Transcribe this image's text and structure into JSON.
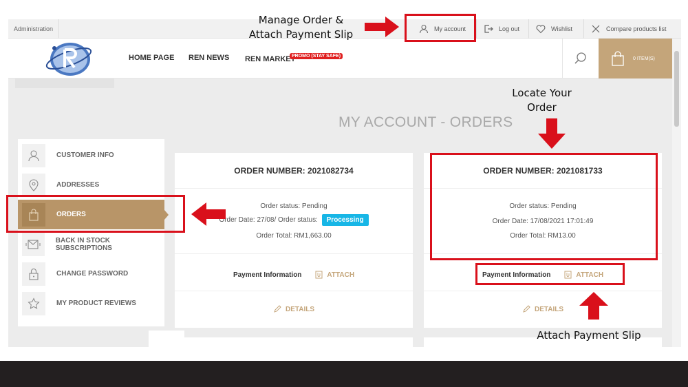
{
  "topbar": {
    "admin": "Administration",
    "my_account": "My account",
    "logout": "Log out",
    "wishlist": "Wishlist",
    "compare": "Compare products list"
  },
  "header": {
    "nav": [
      "HOME PAGE",
      "REN NEWS",
      "REN MARKET"
    ],
    "promo_badge": "PROMO (STAY SAFE)",
    "cart_label": "0 ITEM(S)"
  },
  "page_title": "MY ACCOUNT - ORDERS",
  "sidebar": {
    "items": [
      {
        "label": "CUSTOMER INFO",
        "icon": "user-icon"
      },
      {
        "label": "ADDRESSES",
        "icon": "location-pin-icon"
      },
      {
        "label": "ORDERS",
        "icon": "bag-icon"
      },
      {
        "label": "BACK IN STOCK SUBSCRIPTIONS",
        "icon": "envelope-icon"
      },
      {
        "label": "CHANGE PASSWORD",
        "icon": "lock-icon"
      },
      {
        "label": "MY PRODUCT REVIEWS",
        "icon": "star-icon"
      }
    ],
    "active_index": 2
  },
  "orders": [
    {
      "title": "ORDER NUMBER: 2021082734",
      "status": "Order status: Pending",
      "date_prefix": "Order Date: 27/08/",
      "overlay_status": "Order status:",
      "badge": "Processing",
      "total": "Order Total: RM1,663.00",
      "payment_label": "Payment Information",
      "attach_label": "ATTACH",
      "details_label": "DETAILS"
    },
    {
      "title": "ORDER NUMBER: 2021081733",
      "status": "Order status: Pending",
      "date": "Order Date: 17/08/2021 17:01:49",
      "total": "Order Total: RM13.00",
      "payment_label": "Payment Information",
      "attach_label": "ATTACH",
      "details_label": "DETAILS"
    }
  ],
  "annotations": {
    "manage_line1": "Manage Order &",
    "manage_line2": "Attach Payment Slip",
    "locate_line1": "Locate Your",
    "locate_line2": "Order",
    "attach_slip": "Attach Payment Slip"
  },
  "colors": {
    "accent_gold": "#c4a57a",
    "sidebar_active": "#b89568",
    "badge_blue": "#17b6e6",
    "annotation_red": "#d9101b"
  }
}
